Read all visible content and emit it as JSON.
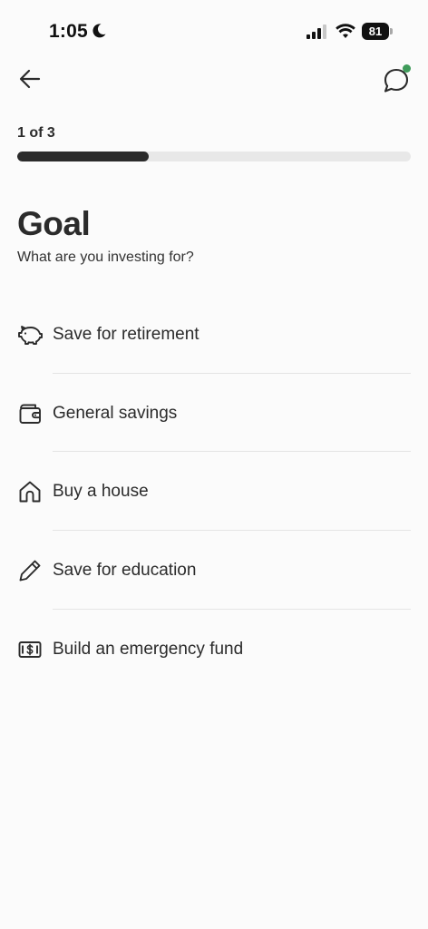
{
  "status_bar": {
    "time": "1:05",
    "battery_level": "81"
  },
  "header": {
    "back_icon": "arrow-left-icon",
    "chat_icon": "chat-bubble-icon",
    "notification_dot_color": "#3f9b5a"
  },
  "progress": {
    "label": "1 of 3",
    "fraction": 0.333,
    "fill_color": "#2b2b2b",
    "track_color": "#e8e8e8"
  },
  "page": {
    "title": "Goal",
    "subtitle": "What are you investing for?"
  },
  "options": [
    {
      "label": "Save for retirement",
      "icon": "piggy-bank-icon"
    },
    {
      "label": "General savings",
      "icon": "wallet-icon"
    },
    {
      "label": "Buy a house",
      "icon": "house-icon"
    },
    {
      "label": "Save for education",
      "icon": "pencil-icon"
    },
    {
      "label": "Build an emergency fund",
      "icon": "cash-icon"
    }
  ]
}
